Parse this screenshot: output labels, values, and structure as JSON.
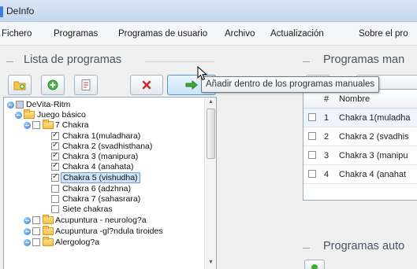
{
  "window": {
    "title": "DeInfo"
  },
  "menu": [
    "Fichero",
    "Programas",
    "Programas de usuario",
    "Archivo",
    "Actualización",
    "Sobre el pro"
  ],
  "left_panel": {
    "title": "Lista de programas"
  },
  "right_panel": {
    "title": "Programas man",
    "auto_title": "Programas auto"
  },
  "tooltip": "Añadir dentro de los programas manuales",
  "tree": [
    {
      "label": "DeVita-Ritm"
    },
    {
      "label": "Juego básico"
    },
    {
      "label": "7 Chakra"
    },
    {
      "label": "Chakra 1(muladhara)"
    },
    {
      "label": "Chakra 2 (svadhisthana)"
    },
    {
      "label": "Chakra 3 (manipura)"
    },
    {
      "label": "Chakra 4 (anahata)"
    },
    {
      "label": "Chakra 5 (vishudha)"
    },
    {
      "label": "Chakra 6 (adzhna)"
    },
    {
      "label": "Chakra 7 (sahasrara)"
    },
    {
      "label": "Siete chakras"
    },
    {
      "label": "Acupuntura - neurolog?a"
    },
    {
      "label": "Acupuntura -gl?ndula tiroides"
    },
    {
      "label": "Alergolog?a"
    }
  ],
  "grid": {
    "col_num": "#",
    "col_name": "Nombre",
    "rows": [
      {
        "num": "1",
        "name": "Chakra 1(muladha"
      },
      {
        "num": "2",
        "name": "Chakra 2 (svadhis"
      },
      {
        "num": "3",
        "name": "Chakra 3 (manipu"
      },
      {
        "num": "4",
        "name": "Chakra 4 (anahat"
      }
    ]
  }
}
